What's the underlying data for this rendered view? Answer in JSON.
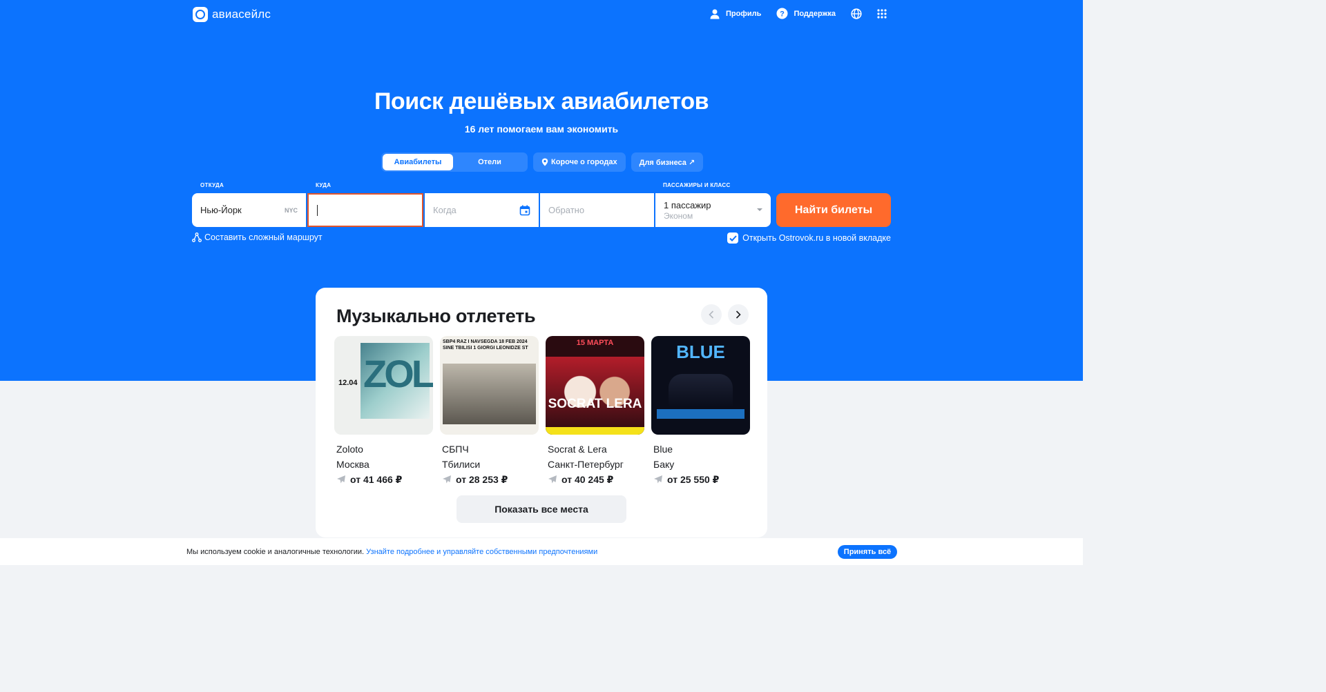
{
  "header": {
    "logo_text": "авиасейлс",
    "profile": "Профиль",
    "support": "Поддержка"
  },
  "hero": {
    "title": "Поиск дешёвых авиабилетов",
    "subtitle": "16 лет помогаем вам экономить"
  },
  "tabs": {
    "flights": "Авиабилеты",
    "hotels": "Отели",
    "cities": "Короче о городах",
    "business": "Для бизнеса ↗"
  },
  "search": {
    "from_label": "ОТКУДА",
    "from_value": "Нью-Йорк",
    "from_code": "NYC",
    "to_label": "КУДА",
    "when_placeholder": "Когда",
    "back_placeholder": "Обратно",
    "pax_label": "ПАССАЖИРЫ И КЛАСС",
    "pax_count": "1 пассажир",
    "pax_class": "Эконом",
    "submit": "Найти билеты",
    "complex_route": "Составить сложный маршрут",
    "ostrovok": "Открыть Ostrovok.ru в новой вкладке",
    "ostrovok_checked": true
  },
  "events_section": {
    "title": "Музыкально отлететь",
    "show_all": "Показать все места",
    "items": [
      {
        "name": "Zoloto",
        "city": "Москва",
        "price": "от 41 466 ₽"
      },
      {
        "name": "СБПЧ",
        "city": "Тбилиси",
        "price": "от 28 253 ₽"
      },
      {
        "name": "Socrat & Lera",
        "city": "Санкт-Петербург",
        "price": "от 40 245 ₽"
      },
      {
        "name": "Blue",
        "city": "Баку",
        "price": "от 25 550 ₽"
      }
    ]
  },
  "posters": {
    "p1_big": "ZOLOTO",
    "p1_date": "12.04",
    "p2_header": "SBP4 RAZ I NAVSEGDA 18 FEB 2024 SINE TBILISI 1 GIORGI LEONIDZE ST",
    "p3_top": "15 МАРТА",
    "p3_name": "SOCRAT LERA",
    "p4_title": "BLUE"
  },
  "cookie": {
    "text": "Мы используем cookie и аналогичные технологии. ",
    "link": "Узнайте подробнее и управляйте собственными предпочтениями",
    "accept": "Принять всё"
  },
  "colors": {
    "brand_blue": "#0c73fe",
    "cta_orange": "#ff6a2c",
    "focus_red": "#e2552b"
  }
}
